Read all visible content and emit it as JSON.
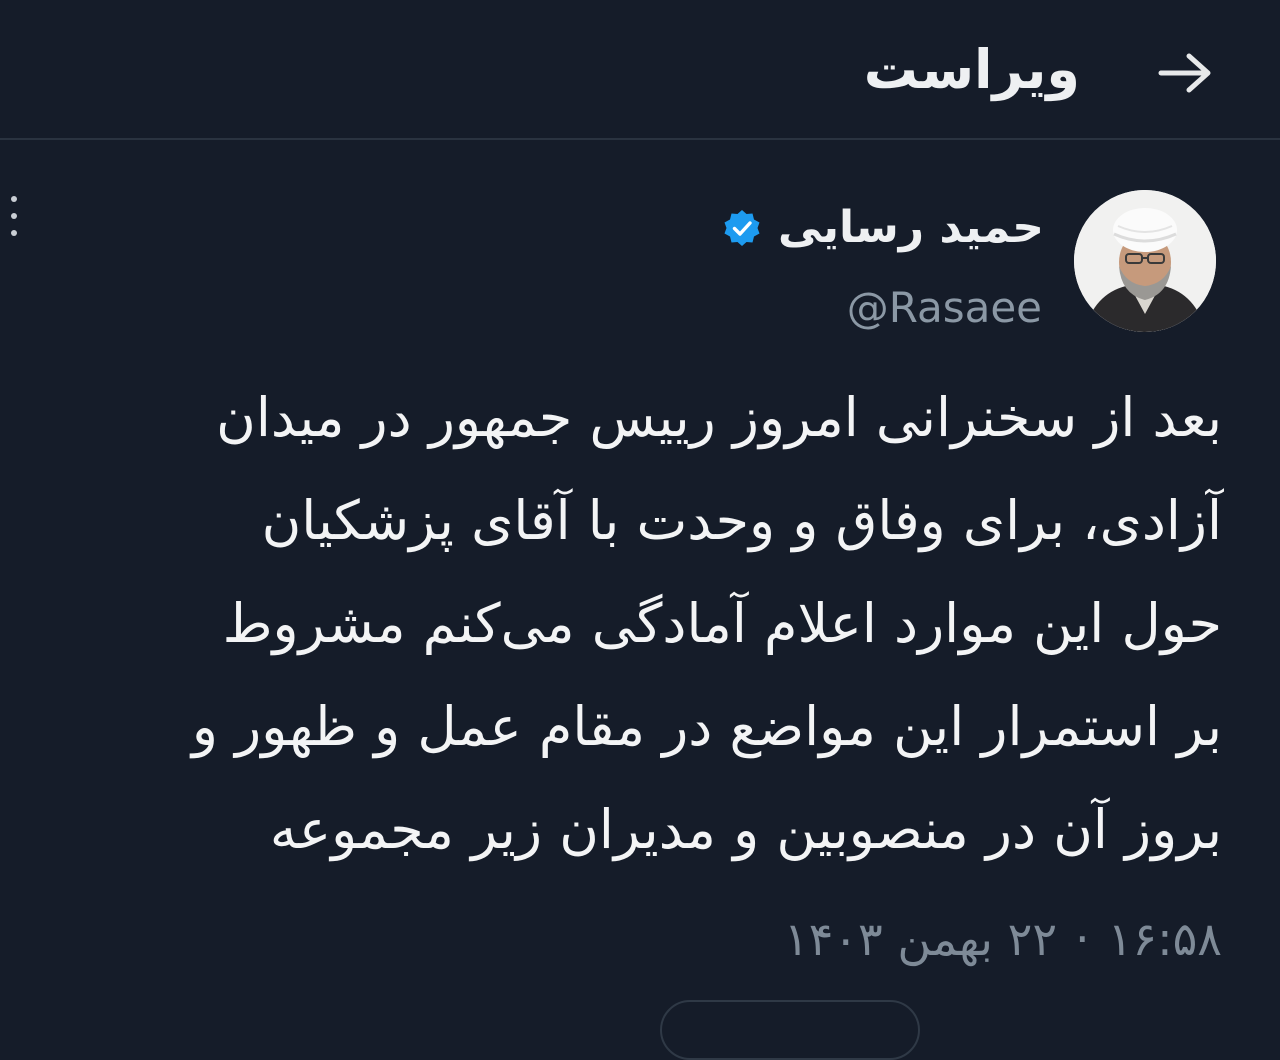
{
  "header": {
    "title": "ویراست",
    "back_icon": "arrow-right-icon"
  },
  "tweet": {
    "display_name": "حمید رسایی",
    "verified": true,
    "verified_color": "#1d9bf0",
    "handle": "@Rasaee",
    "more_icon": "vertical-dots-icon",
    "lines": [
      "بعد از سخنرانی امروز رییس جمهور در میدان",
      "آزادی، برای وفاق و وحدت با آقای پزشکیان",
      "حول این موارد اعلام آمادگی می‌کنم مشروط",
      "بر استمرار این مواضع در مقام عمل و ظهور و",
      "بروز آن در منصوبین و مدیران زیر مجموعه"
    ],
    "time": "۱۶:۵۸",
    "separator": "·",
    "date": "۲۲ بهمن ۱۴۰۳"
  }
}
